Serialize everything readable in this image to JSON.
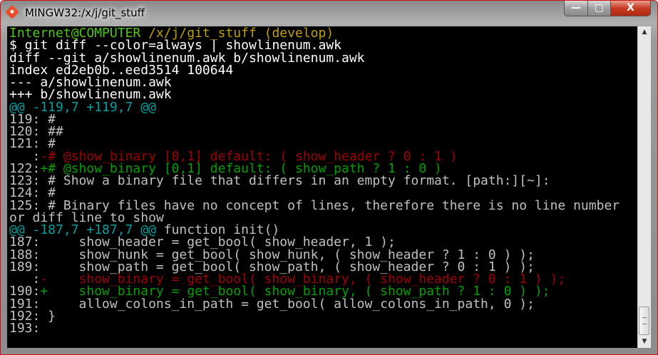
{
  "window": {
    "title": "MINGW32:/x/j/git_stuff",
    "minimize_label": "—",
    "maximize_label": "▢",
    "close_label": "X"
  },
  "colors": {
    "default": "#c0c0c0",
    "bright": "#ffffff",
    "user": "#4fc80a",
    "path": "#c0a000",
    "hunk": "#00a0a0",
    "removed": "#a00000",
    "added": "#00a000"
  },
  "scrollbar": {
    "up_icon": "▲",
    "down_icon": "▼",
    "position_fraction": 0.95
  },
  "terminal": {
    "lines": [
      [
        {
          "t": "Internet@COMPUTER ",
          "c": "user"
        },
        {
          "t": "/x/j/git_stuff (develop)",
          "c": "path"
        }
      ],
      [
        {
          "t": "$ git diff --color=always | showlinenum.awk",
          "c": "bright"
        }
      ],
      [
        {
          "t": "diff --git a/showlinenum.awk b/showlinenum.awk",
          "c": "bright"
        }
      ],
      [
        {
          "t": "index ed2eb0b..eed3514 100644",
          "c": "bright"
        }
      ],
      [
        {
          "t": "--- a/showlinenum.awk",
          "c": "bright"
        }
      ],
      [
        {
          "t": "+++ b/showlinenum.awk",
          "c": "bright"
        }
      ],
      [
        {
          "t": "@@ -119,7 +119,7 @@",
          "c": "hunk"
        }
      ],
      [
        {
          "t": "119: #",
          "c": "default"
        }
      ],
      [
        {
          "t": "120: ##",
          "c": "default"
        }
      ],
      [
        {
          "t": "121: #",
          "c": "default"
        }
      ],
      [
        {
          "t": "   :",
          "c": "default"
        },
        {
          "t": "-# @show_binary [0,1] default: ( show_header ? 0 : 1 )",
          "c": "removed"
        }
      ],
      [
        {
          "t": "122:",
          "c": "default"
        },
        {
          "t": "+# @show_binary [0,1] default: ( show_path ? 1 : 0 )",
          "c": "added"
        }
      ],
      [
        {
          "t": "123: # Show a binary file that differs in an empty format. [path:][~]:",
          "c": "default"
        }
      ],
      [
        {
          "t": "124: #",
          "c": "default"
        }
      ],
      [
        {
          "t": "125: # Binary files have no concept of lines, therefore there is no line number",
          "c": "default"
        }
      ],
      [
        {
          "t": "or diff line to show",
          "c": "default"
        }
      ],
      [
        {
          "t": "@@ -187,7 +187,7 @@",
          "c": "hunk"
        },
        {
          "t": " function init()",
          "c": "default"
        }
      ],
      [
        {
          "t": "187:     show_header = get_bool( show_header, 1 );",
          "c": "default"
        }
      ],
      [
        {
          "t": "188:     show_hunk = get_bool( show_hunk, ( show_header ? 1 : 0 ) );",
          "c": "default"
        }
      ],
      [
        {
          "t": "189:     show_path = get_bool( show_path, ( show_header ? 0 : 1 ) );",
          "c": "default"
        }
      ],
      [
        {
          "t": "   :",
          "c": "default"
        },
        {
          "t": "-    show_binary = get_bool( show_binary, ( show_header ? 0 : 1 ) );",
          "c": "removed"
        }
      ],
      [
        {
          "t": "190:",
          "c": "default"
        },
        {
          "t": "+    show_binary = get_bool( show_binary, ( show_path ? 1 : 0 ) );",
          "c": "added"
        }
      ],
      [
        {
          "t": "191:     allow_colons_in_path = get_bool( allow_colons_in_path, 0 );",
          "c": "default"
        }
      ],
      [
        {
          "t": "192: }",
          "c": "default"
        }
      ],
      [
        {
          "t": "193:",
          "c": "default"
        }
      ]
    ]
  }
}
